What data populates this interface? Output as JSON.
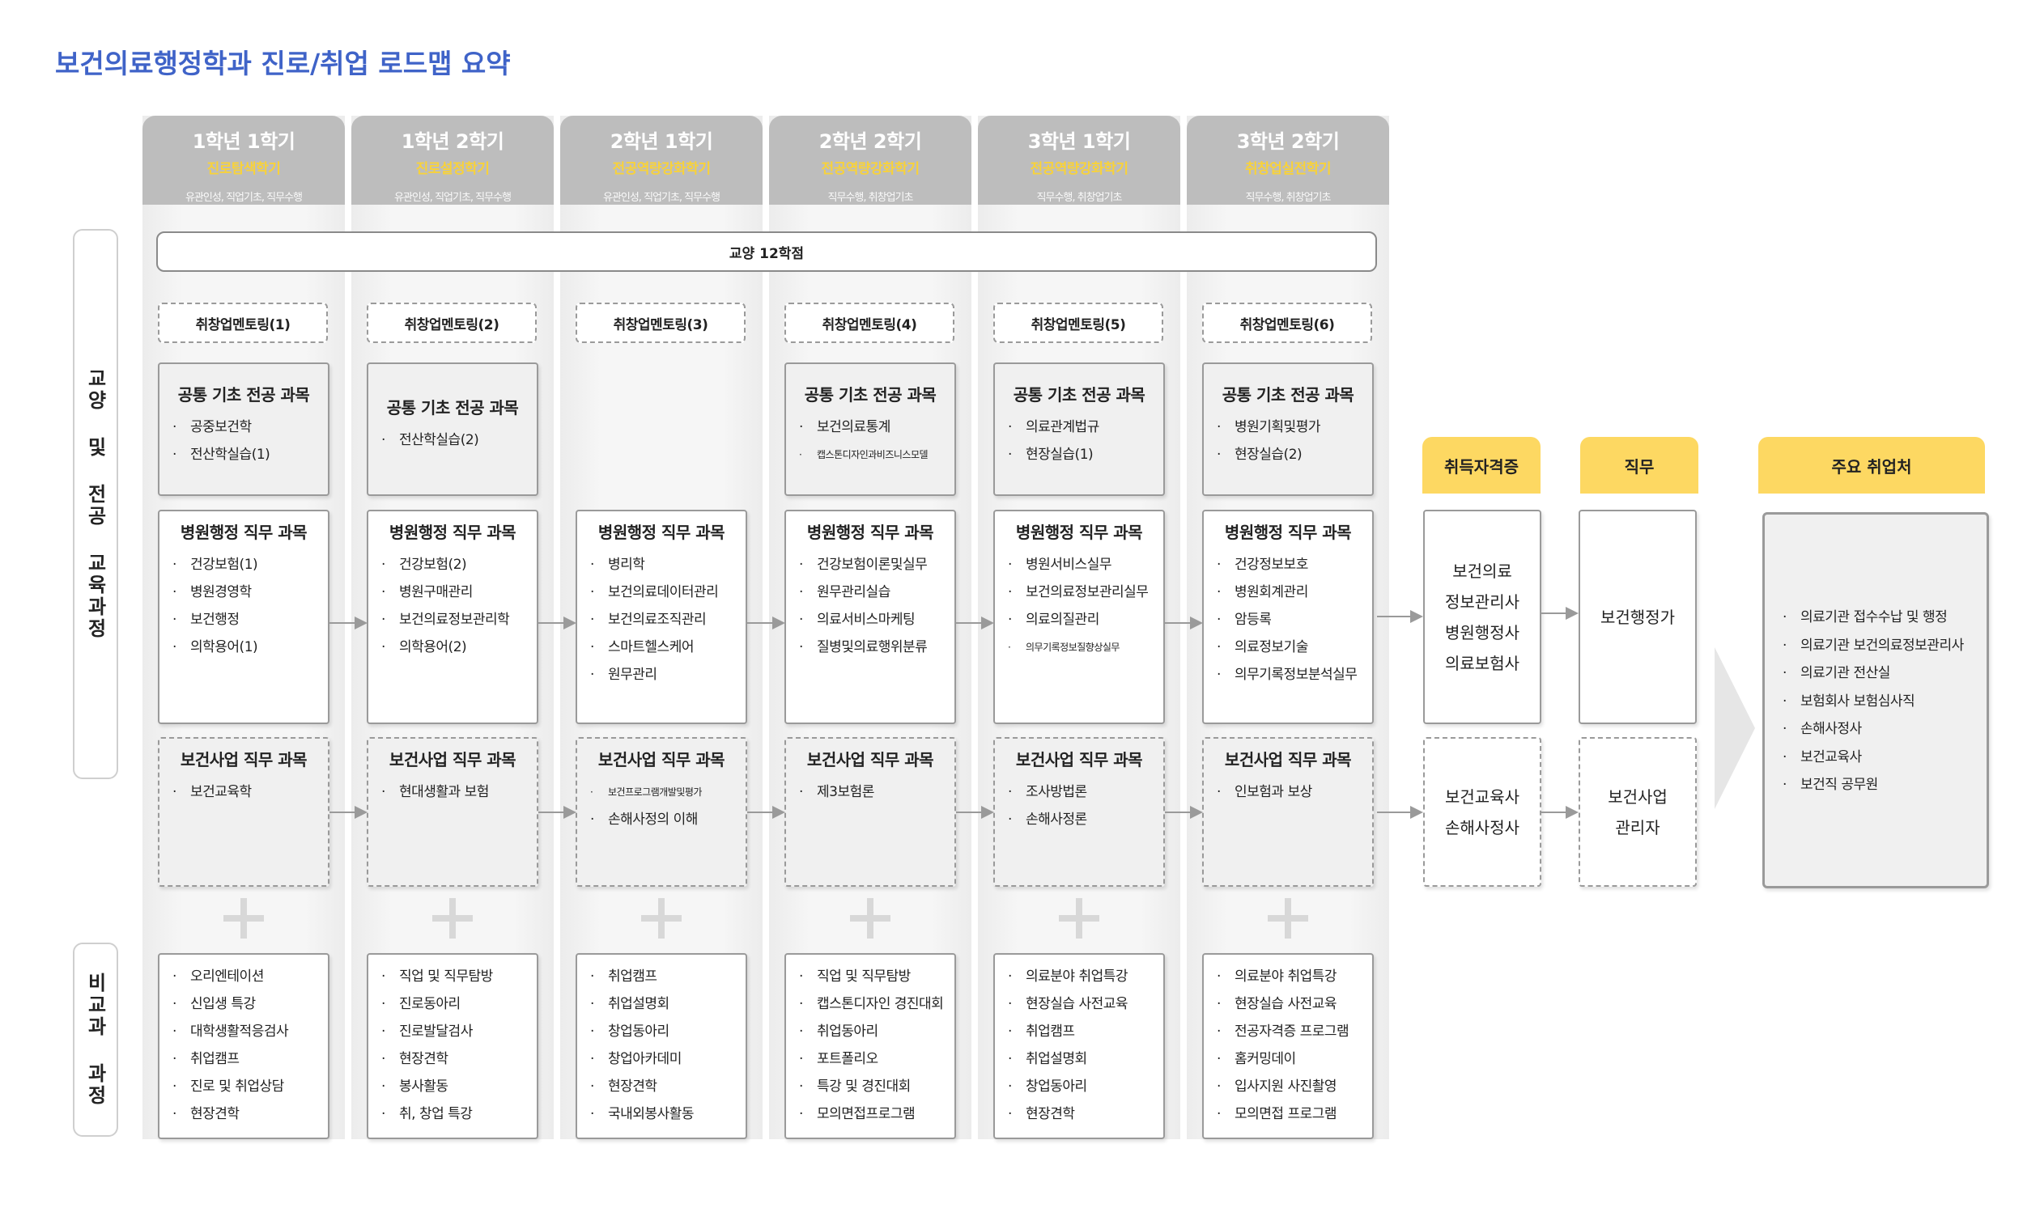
{
  "title": "보건의료행정학과 진로/취업 로드맵 요약",
  "side_labels": {
    "curriculum": "교양 및 전공 교육과정",
    "extracurricular": "비교과 과정"
  },
  "general_ed": "교양 12학점",
  "columns": [
    {
      "semester": "1학년 1학기",
      "theme": "진로탐색학기",
      "competency": "유관인성, 직업기초, 직무수행",
      "mentoring": "취창업멘토링(1)",
      "common": {
        "title": "공통 기초 전공 과목",
        "items": [
          "공중보건학",
          "전산학실습(1)"
        ]
      },
      "hospital": {
        "title": "병원행정 직무 과목",
        "items": [
          "건강보험(1)",
          "병원경영학",
          "보건행정",
          "의학용어(1)"
        ]
      },
      "health": {
        "title": "보건사업 직무 과목",
        "items": [
          "보건교육학"
        ]
      },
      "extra": [
        "오리엔테이션",
        "신입생 특강",
        "대학생활적응검사",
        "취업캠프",
        "진로 및 취업상담",
        "현장견학"
      ]
    },
    {
      "semester": "1학년 2학기",
      "theme": "진로설정학기",
      "competency": "유관인성, 직업기초, 직무수행",
      "mentoring": "취창업멘토링(2)",
      "common": {
        "title": "공통 기초 전공 과목",
        "items": [
          "전산학실습(2)"
        ]
      },
      "hospital": {
        "title": "병원행정 직무 과목",
        "items": [
          "건강보험(2)",
          "병원구매관리",
          "보건의료정보관리학",
          "의학용어(2)"
        ]
      },
      "health": {
        "title": "보건사업 직무 과목",
        "items": [
          "현대생활과 보험"
        ]
      },
      "extra": [
        "직업 및 직무탐방",
        "진로동아리",
        "진로발달검사",
        "현장견학",
        "봉사활동",
        "취, 창업 특강"
      ]
    },
    {
      "semester": "2학년 1학기",
      "theme": "전공역량강화학기",
      "competency": "유관인성, 직업기초, 직무수행",
      "mentoring": "취창업멘토링(3)",
      "common": null,
      "hospital": {
        "title": "병원행정 직무 과목",
        "items": [
          "병리학",
          "보건의료데이터관리",
          "보건의료조직관리",
          "스마트헬스케어",
          "원무관리"
        ]
      },
      "health": {
        "title": "보건사업 직무 과목",
        "items": [
          "보건프로그램개발및평가",
          "손해사정의 이해"
        ]
      },
      "extra": [
        "취업캠프",
        "취업설명회",
        "창업동아리",
        "창업아카데미",
        "현장견학",
        "국내외봉사활동"
      ]
    },
    {
      "semester": "2학년 2학기",
      "theme": "전공역량강화학기",
      "competency": "직무수행, 취창업기초",
      "mentoring": "취창업멘토링(4)",
      "common": {
        "title": "공통 기초 전공 과목",
        "items": [
          "보건의료통계",
          "캡스톤디자인과비즈니스모델"
        ]
      },
      "hospital": {
        "title": "병원행정 직무 과목",
        "items": [
          "건강보험이론및실무",
          "원무관리실습",
          "의료서비스마케팅",
          "질병및의료행위분류"
        ]
      },
      "health": {
        "title": "보건사업 직무 과목",
        "items": [
          "제3보험론"
        ]
      },
      "extra": [
        "직업 및 직무탐방",
        "캡스톤디자인 경진대회",
        "취업동아리",
        "포트폴리오",
        "특강 및 경진대회",
        "모의면접프로그램"
      ]
    },
    {
      "semester": "3학년 1학기",
      "theme": "전공역량강화학기",
      "competency": "직무수행, 취창업기초",
      "mentoring": "취창업멘토링(5)",
      "common": {
        "title": "공통 기초 전공 과목",
        "items": [
          "의료관계법규",
          "현장실습(1)"
        ]
      },
      "hospital": {
        "title": "병원행정 직무 과목",
        "items": [
          "병원서비스실무",
          "보건의료정보관리실무",
          "의료의질관리",
          "의무기록정보질향상실무"
        ]
      },
      "health": {
        "title": "보건사업 직무 과목",
        "items": [
          "조사방법론",
          "손해사정론"
        ]
      },
      "extra": [
        "의료분야 취업특강",
        "현장실습 사전교육",
        "취업캠프",
        "취업설명회",
        "창업동아리",
        "현장견학"
      ]
    },
    {
      "semester": "3학년 2학기",
      "theme": "취창업실전학기",
      "competency": "직무수행, 취창업기초",
      "mentoring": "취창업멘토링(6)",
      "common": {
        "title": "공통 기초 전공 과목",
        "items": [
          "병원기획및평가",
          "현장실습(2)"
        ]
      },
      "hospital": {
        "title": "병원행정 직무 과목",
        "items": [
          "건강정보보호",
          "병원회계관리",
          "암등록",
          "의료정보기술",
          "의무기록정보분석실무"
        ]
      },
      "health": {
        "title": "보건사업 직무 과목",
        "items": [
          "인보험과 보상"
        ]
      },
      "extra": [
        "의료분야 취업특강",
        "현장실습 사전교육",
        "전공자격증 프로그램",
        "홈커밍데이",
        "입사지원 사진촬영",
        "모의면접 프로그램"
      ]
    }
  ],
  "outcomes": {
    "certificate_header": "취득자격증",
    "job_header": "직무",
    "employer_header": "주요 취업처",
    "certificates_hospital": [
      "보건의료",
      "정보관리사",
      "병원행정사",
      "의료보험사"
    ],
    "certificates_health": [
      "보건교육사",
      "손해사정사"
    ],
    "job_hospital": "보건행정가",
    "job_health": [
      "보건사업",
      "관리자"
    ],
    "employers": [
      "의료기관 접수수납 및 행정",
      "의료기관 보건의료정보관리사",
      "의료기관 전산실",
      "보험회사 보험심사직",
      "손해사정사",
      "보건교육사",
      "보건직 공무원"
    ]
  },
  "colors": {
    "title": "#3f63c8",
    "column_header": "#bdbdbd",
    "theme_text": "#f8d23a",
    "outcome_header": "#fdd862"
  }
}
